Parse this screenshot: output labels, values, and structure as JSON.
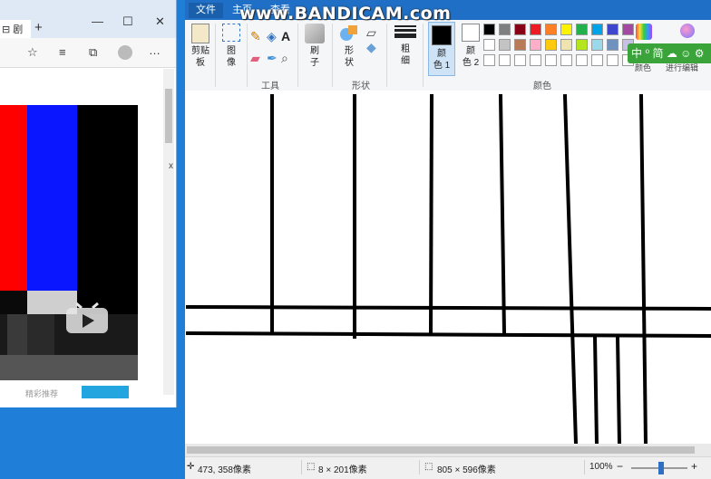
{
  "browser": {
    "tab_glyph": "⊟ 剧",
    "new_tab": "+",
    "window_controls": {
      "min": "—",
      "max": "☐",
      "close": "✕"
    },
    "toolbar_icons": [
      "…",
      "☆",
      "☆≡",
      "⧉",
      "●",
      "…"
    ],
    "side_glyph": "x",
    "bottom_text": "精彩推荐"
  },
  "paint": {
    "menu": {
      "file": "文件",
      "home": "主页",
      "view": "查看"
    },
    "ribbon": {
      "clipboard_label": "剪贴\n板",
      "image_label": "图\n像",
      "tools_group": "工具",
      "brush_label": "刷\n子",
      "shapes_label": "形\n状",
      "shapes_group": "形状",
      "size_label": "粗\n细",
      "color1_label": "颜\n色 1",
      "color2_label": "颜\n色 2",
      "colors_group": "颜色",
      "edit_colors_label": "颜色",
      "edit_with_3d_label": "进行编辑"
    },
    "palette_row1": [
      "#000000",
      "#7f7f7f",
      "#880015",
      "#ed1c24",
      "#ff7f27",
      "#fff200",
      "#22b14c",
      "#00a2e8",
      "#3f48cc",
      "#a349a4"
    ],
    "palette_row2": [
      "#ffffff",
      "#c3c3c3",
      "#b97a57",
      "#ffaec9",
      "#ffc90e",
      "#efe4b0",
      "#b5e61d",
      "#99d9ea",
      "#7092be",
      "#c8bfe7"
    ],
    "palette_row3": [
      "#ffffff",
      "#ffffff",
      "#ffffff",
      "#ffffff",
      "#ffffff",
      "#ffffff",
      "#ffffff",
      "#ffffff",
      "#ffffff",
      "#ffffff"
    ],
    "status": {
      "cursor_pos": "473, 358像素",
      "selection_size": "8 × 201像素",
      "image_size": "805 × 596像素",
      "zoom": "100%",
      "zoom_minus": "−",
      "zoom_plus": "+"
    }
  },
  "overlay": {
    "watermark": "www.BANDICAM.com",
    "ime": "中 ⁰ 简 ☁ ☺ ⚙"
  }
}
